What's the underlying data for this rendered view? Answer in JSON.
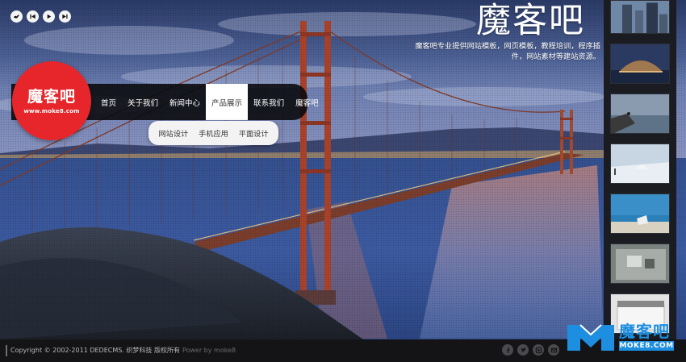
{
  "brand": {
    "title": "魔客吧",
    "description": "魔客吧专业提供网站模板，网页模板，教程培训，程序插件，网站素材等建站资源。"
  },
  "logo": {
    "text": "魔客吧",
    "url": "www.moke8.com"
  },
  "media_controls": [
    {
      "icon": "bird-icon"
    },
    {
      "icon": "previous-icon"
    },
    {
      "icon": "play-icon"
    },
    {
      "icon": "next-icon"
    }
  ],
  "nav": {
    "items": [
      {
        "label": "首页"
      },
      {
        "label": "关于我们"
      },
      {
        "label": "新闻中心"
      },
      {
        "label": "产品展示",
        "active": true
      },
      {
        "label": "联系我们"
      },
      {
        "label": "魔客吧"
      }
    ],
    "submenu": [
      {
        "label": "网站设计"
      },
      {
        "label": "手机应用"
      },
      {
        "label": "平面设计"
      }
    ]
  },
  "thumbnails": [
    {
      "name": "thumb-skyscrapers"
    },
    {
      "name": "thumb-dome-building"
    },
    {
      "name": "thumb-seaside-cliff"
    },
    {
      "name": "thumb-snowy-lake"
    },
    {
      "name": "thumb-beach-chair"
    },
    {
      "name": "thumb-table-top"
    },
    {
      "name": "thumb-bed-room"
    }
  ],
  "footer": {
    "copyright": "Copyright © 2002-2011 DEDECMS. 织梦科技 版权所有",
    "powered": "Power by moke8",
    "social": [
      {
        "icon": "facebook-icon"
      },
      {
        "icon": "twitter-icon"
      },
      {
        "icon": "share-icon"
      },
      {
        "icon": "email-icon"
      }
    ]
  },
  "watermark": {
    "label": "魔客吧",
    "url": "MOKE8.COM"
  },
  "colors": {
    "logo_red": "#e6262b",
    "nav_bg": "#08080a",
    "watermark_blue": "#1e8fe0"
  }
}
